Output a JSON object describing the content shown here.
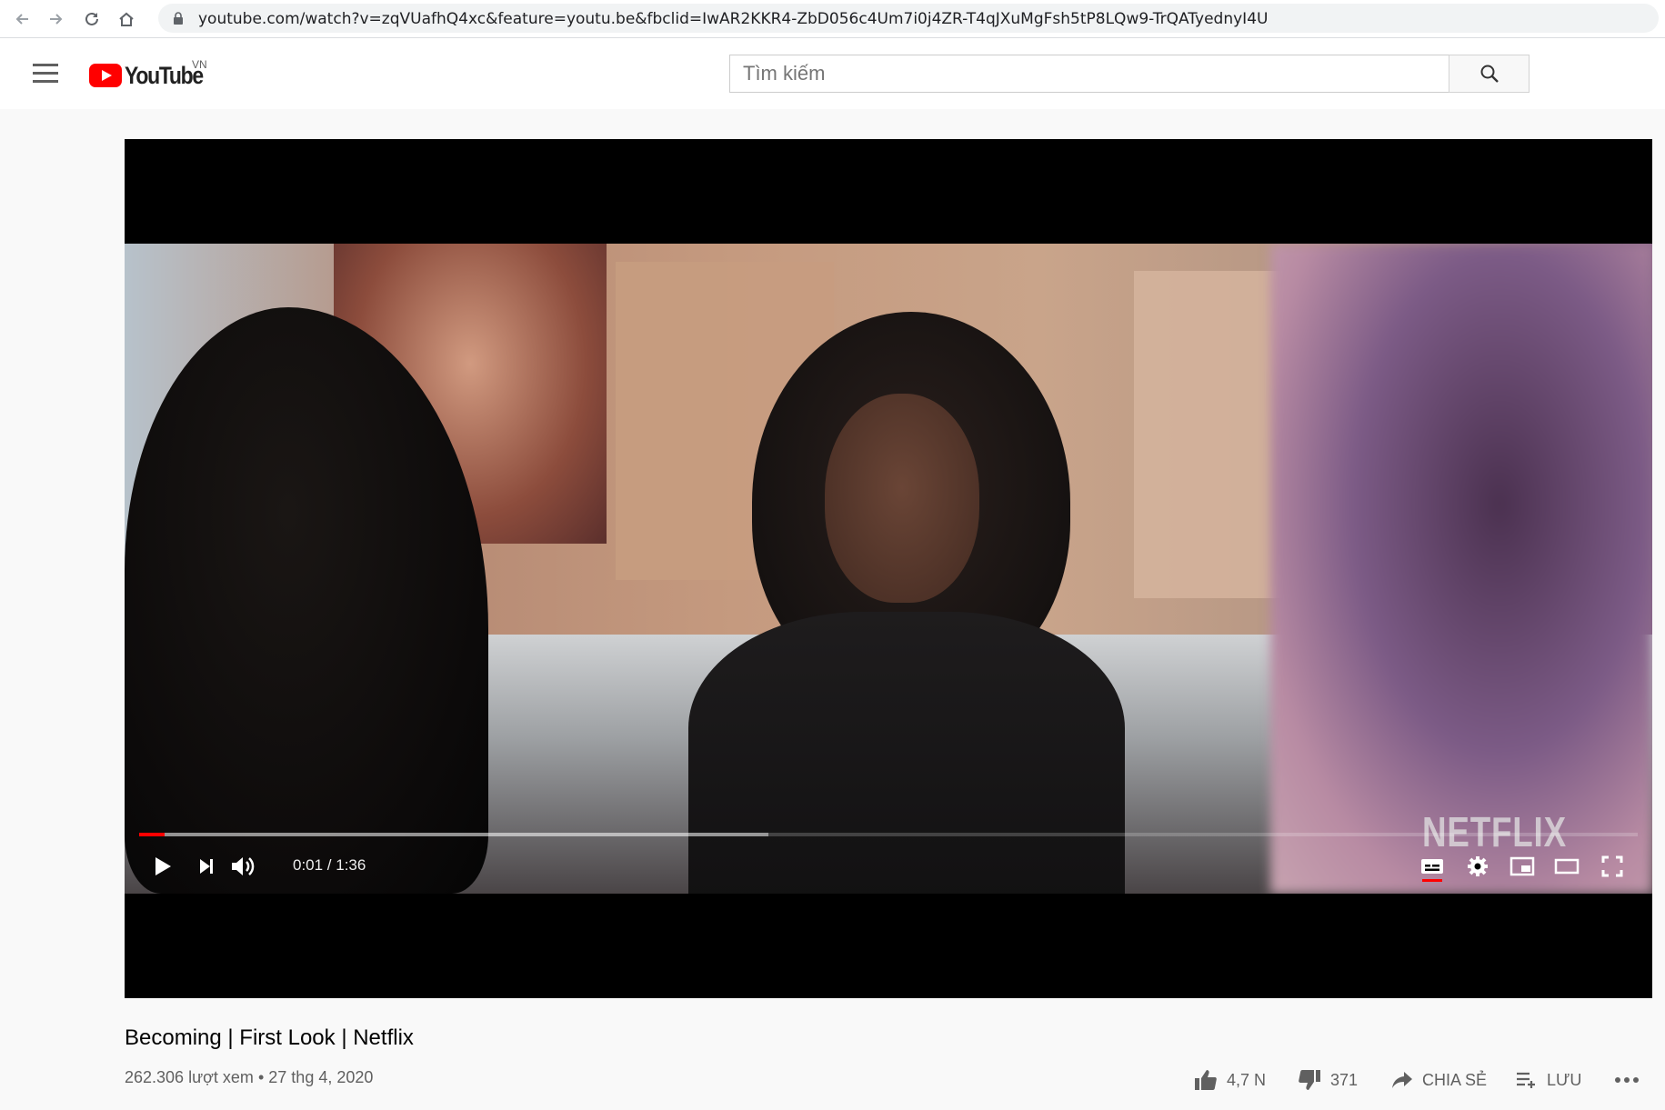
{
  "browser": {
    "url": "youtube.com/watch?v=zqVUafhQ4xc&feature=youtu.be&fbclid=IwAR2KKR4-ZbD056c4Um7i0j4ZR-T4qJXuMgFsh5tP8LQw9-TrQATyednyI4U"
  },
  "masthead": {
    "logo_text": "YouTube",
    "country_code": "VN",
    "search_placeholder": "Tìm kiếm"
  },
  "player": {
    "watermark": "NETFLIX",
    "time_display": "0:01 / 1:36",
    "progress_played": 0.017,
    "progress_buffered": 0.42
  },
  "video": {
    "title": "Becoming | First Look | Netflix",
    "views": "262.306 lượt xem",
    "separator": "•",
    "date": "27 thg 4, 2020",
    "likes": "4,7 N",
    "dislikes": "371",
    "share_label": "CHIA SẺ",
    "save_label": "LƯU"
  },
  "colors": {
    "brand_red": "#ff0000",
    "text_secondary": "#606060"
  }
}
